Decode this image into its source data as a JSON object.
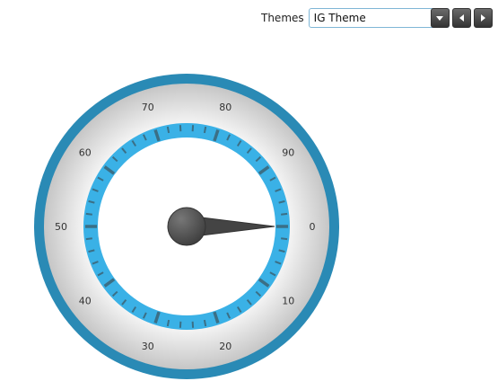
{
  "toolbar": {
    "themes_label": "Themes",
    "selected_theme": "IG Theme"
  },
  "gauge": {
    "type": "radial",
    "scale_labels": [
      "0",
      "10",
      "20",
      "30",
      "40",
      "50",
      "60",
      "70",
      "80",
      "90"
    ],
    "needle_value": 0,
    "colors": {
      "outer_ring": "#2a8ab5",
      "face_light": "#f4f4f4",
      "face_dark": "#c6c6c6",
      "range_band": "#3ab1e6",
      "tick": "#3b6f86",
      "needle": "#444444"
    }
  }
}
